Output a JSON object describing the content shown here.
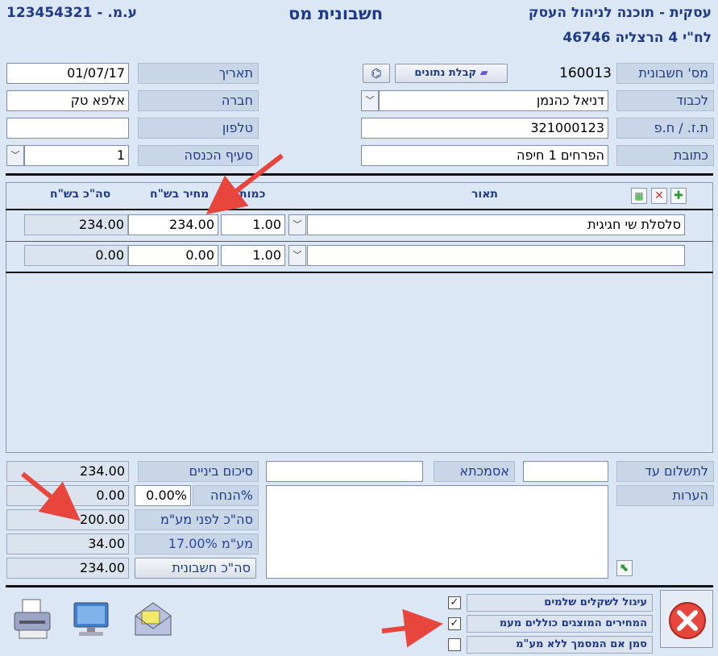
{
  "header": {
    "app_title": "עסקית - תוכנה לניהול העסק",
    "address": "לח\"י 4 הרצליה 46746",
    "document_title": "חשבונית מס",
    "company_id": "ע.מ. -  123454321"
  },
  "invoice": {
    "number_label": "מס' חשבונית",
    "number_value": "160013",
    "receive_data_button": "קבלת נתונים",
    "date_label": "תאריך",
    "date_value": "01/07/17",
    "to_label": "לכבוד",
    "to_value": "דניאל כהנמן",
    "company_label": "חברה",
    "company_value": "אלפא טק",
    "id_label": "ת.ז. / ח.פ",
    "id_value": "321000123",
    "phone_label": "טלפון",
    "phone_value": "",
    "address_label": "כתובת",
    "address_value": "הפרחים 1 חיפה",
    "income_section_label": "סעיף הכנסה",
    "income_section_value": "1"
  },
  "items": {
    "columns": {
      "description": "תאור",
      "quantity": "כמות",
      "price": "מחיר בש\"ח",
      "total": "סה\"כ בש\"ח"
    },
    "rows": [
      {
        "description": "סלסלת שי חגיגית",
        "quantity": "1.00",
        "price": "234.00",
        "total": "234.00"
      },
      {
        "description": "",
        "quantity": "1.00",
        "price": "0.00",
        "total": "0.00"
      }
    ]
  },
  "summary": {
    "subtotal_label": "סיכום ביניים",
    "subtotal_value": "234.00",
    "discount_label": "%הנחה",
    "discount_percent": "0.00%",
    "discount_value": "0.00",
    "before_vat_label": "סה\"כ לפני מע\"מ",
    "before_vat_value": "200.00",
    "vat_label": "מע\"מ 17.00%",
    "vat_value": "34.00",
    "invoice_total_label": "סה\"כ חשבונית",
    "invoice_total_value": "234.00"
  },
  "payment": {
    "due_label": "לתשלום עד",
    "due_value": "",
    "reference_label": "אסמכתא",
    "reference_value": "",
    "notes_label": "הערות",
    "notes_value": ""
  },
  "options": {
    "round_label": "עיגול לשקלים שלמים",
    "round_checked": true,
    "prices_include_vat_label": "המחירים המוצגים כוללים מעמ",
    "prices_include_vat_checked": true,
    "no_vat_label": "סמן אם המסמך ללא מע\"מ",
    "no_vat_checked": false
  },
  "colors": {
    "accent": "#1f3a8c",
    "arrow": "#e8453c",
    "background": "#dbe7f5"
  }
}
